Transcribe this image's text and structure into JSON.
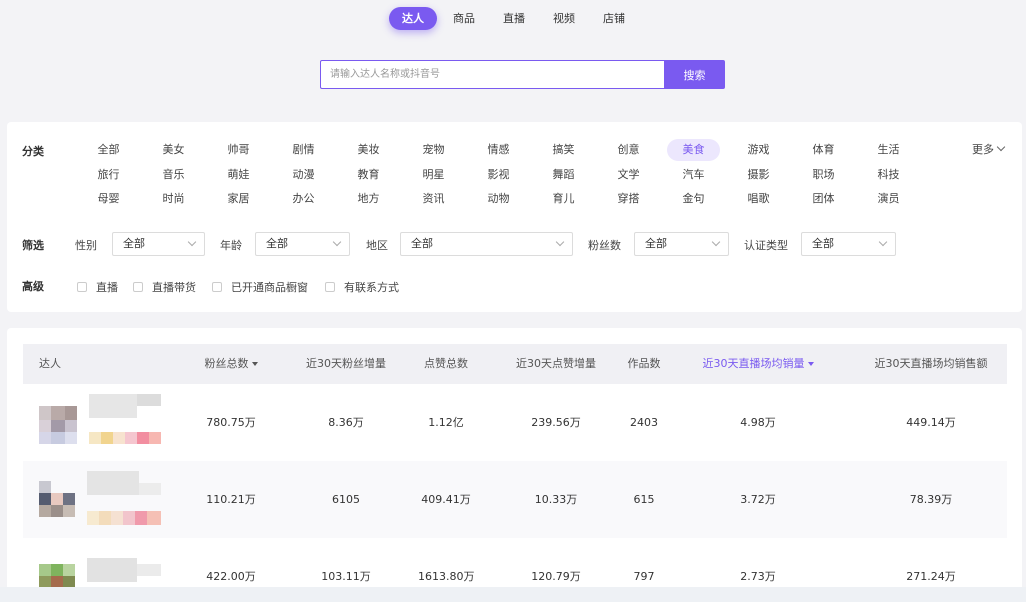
{
  "nav": {
    "tabs": [
      {
        "label": "达人",
        "active": true
      },
      {
        "label": "商品",
        "active": false
      },
      {
        "label": "直播",
        "active": false
      },
      {
        "label": "视频",
        "active": false
      },
      {
        "label": "店铺",
        "active": false
      }
    ]
  },
  "search": {
    "placeholder": "请输入达人名称或抖音号",
    "value": "",
    "button_label": "搜索"
  },
  "filters": {
    "category_label": "分类",
    "categories": [
      {
        "label": "全部"
      },
      {
        "label": "美女"
      },
      {
        "label": "帅哥"
      },
      {
        "label": "剧情"
      },
      {
        "label": "美妆"
      },
      {
        "label": "宠物"
      },
      {
        "label": "情感"
      },
      {
        "label": "搞笑"
      },
      {
        "label": "创意"
      },
      {
        "label": "美食",
        "active": true
      },
      {
        "label": "游戏"
      },
      {
        "label": "体育"
      },
      {
        "label": "生活"
      },
      {
        "label": "旅行"
      },
      {
        "label": "音乐"
      },
      {
        "label": "萌娃"
      },
      {
        "label": "动漫"
      },
      {
        "label": "教育"
      },
      {
        "label": "明星"
      },
      {
        "label": "影视"
      },
      {
        "label": "舞蹈"
      },
      {
        "label": "文学"
      },
      {
        "label": "汽车"
      },
      {
        "label": "摄影"
      },
      {
        "label": "职场"
      },
      {
        "label": "科技"
      },
      {
        "label": "母婴"
      },
      {
        "label": "时尚"
      },
      {
        "label": "家居"
      },
      {
        "label": "办公"
      },
      {
        "label": "地方"
      },
      {
        "label": "资讯"
      },
      {
        "label": "动物"
      },
      {
        "label": "育儿"
      },
      {
        "label": "穿搭"
      },
      {
        "label": "金句"
      },
      {
        "label": "唱歌"
      },
      {
        "label": "团体"
      },
      {
        "label": "演员"
      }
    ],
    "more_label": "更多",
    "screen_label": "筛选",
    "selects": {
      "gender": {
        "label": "性别",
        "value": "全部"
      },
      "age": {
        "label": "年龄",
        "value": "全部"
      },
      "region": {
        "label": "地区",
        "value": "全部"
      },
      "fans": {
        "label": "粉丝数",
        "value": "全部"
      },
      "verify": {
        "label": "认证类型",
        "value": "全部"
      }
    },
    "advanced_label": "高级",
    "checkboxes": [
      {
        "label": "直播",
        "checked": false
      },
      {
        "label": "直播带货",
        "checked": false
      },
      {
        "label": "已开通商品橱窗",
        "checked": false
      },
      {
        "label": "有联系方式",
        "checked": false
      }
    ]
  },
  "table": {
    "columns": [
      {
        "label": "达人"
      },
      {
        "label": "粉丝总数",
        "sort": "desc"
      },
      {
        "label": "近30天粉丝增量"
      },
      {
        "label": "点赞总数"
      },
      {
        "label": "近30天点赞增量"
      },
      {
        "label": "作品数"
      },
      {
        "label": "近30天直播场均销量",
        "sort": "desc",
        "active": true
      },
      {
        "label": "近30天直播场均销售额"
      }
    ],
    "rows": [
      {
        "fans": "780.75万",
        "fans_30d": "8.36万",
        "likes": "1.12亿",
        "likes_30d": "239.56万",
        "works": "2403",
        "live_avg_sales": "4.98万",
        "live_avg_gmv": "449.14万"
      },
      {
        "fans": "110.21万",
        "fans_30d": "6105",
        "likes": "409.41万",
        "likes_30d": "10.33万",
        "works": "615",
        "live_avg_sales": "3.72万",
        "live_avg_gmv": "78.39万"
      },
      {
        "fans": "422.00万",
        "fans_30d": "103.11万",
        "likes": "1613.80万",
        "likes_30d": "120.79万",
        "works": "797",
        "live_avg_sales": "2.73万",
        "live_avg_gmv": "271.24万"
      }
    ]
  },
  "colors": {
    "accent": "#7a5af0",
    "accent_light": "#ece7fd",
    "panel": "#ffffff",
    "page": "#f3f3f6"
  }
}
